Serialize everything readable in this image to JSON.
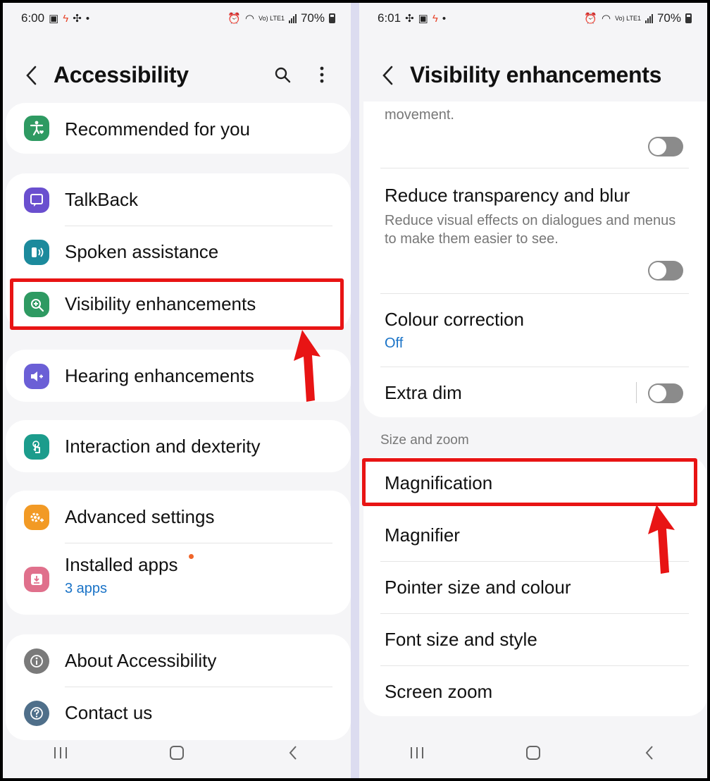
{
  "left": {
    "status": {
      "time": "6:00",
      "battery": "70%",
      "net": "Vo) LTE1"
    },
    "title": "Accessibility",
    "items": [
      {
        "label": "Recommended for you"
      },
      {
        "label": "TalkBack"
      },
      {
        "label": "Spoken assistance"
      },
      {
        "label": "Visibility enhancements"
      },
      {
        "label": "Hearing enhancements"
      },
      {
        "label": "Interaction and dexterity"
      },
      {
        "label": "Advanced settings"
      },
      {
        "label": "Installed apps",
        "sub": "3 apps"
      },
      {
        "label": "About Accessibility"
      },
      {
        "label": "Contact us"
      }
    ],
    "colors": {
      "green": "#2e9a62",
      "purple": "#6a4fcf",
      "teal": "#1c8a9c",
      "violet": "#6b5fd6",
      "orange": "#f29a25",
      "pink": "#e0708c",
      "gray": "#7a7a7a",
      "slate": "#4f6f8a"
    }
  },
  "right": {
    "status": {
      "time": "6:01",
      "battery": "70%",
      "net": "Vo) LTE1"
    },
    "title": "Visibility enhancements",
    "top_partial": "movement.",
    "reduce_transparency": {
      "title": "Reduce transparency and blur",
      "desc": "Reduce visual effects on dialogues and menus to make them easier to see."
    },
    "colour_correction": {
      "title": "Colour correction",
      "value": "Off"
    },
    "extra_dim": {
      "title": "Extra dim"
    },
    "section": "Size and zoom",
    "items": [
      {
        "label": "Magnification"
      },
      {
        "label": "Magnifier"
      },
      {
        "label": "Pointer size and colour"
      },
      {
        "label": "Font size and style"
      },
      {
        "label": "Screen zoom"
      }
    ]
  },
  "highlight_color": "#e81414"
}
